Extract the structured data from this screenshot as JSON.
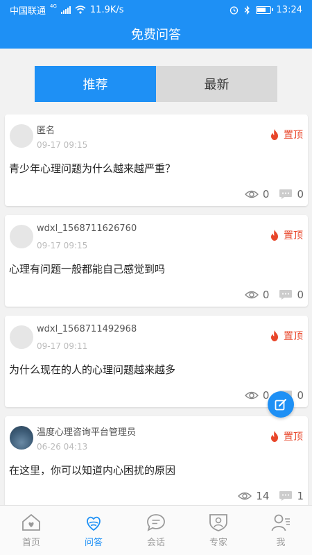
{
  "status": {
    "carrier": "中国联通",
    "network_badge": "4G",
    "speed": "11.9K/s",
    "time": "13:24"
  },
  "header": {
    "title": "免费问答"
  },
  "tabs": [
    {
      "label": "推荐",
      "active": true
    },
    {
      "label": "最新",
      "active": false
    }
  ],
  "posts": [
    {
      "user": "匿名",
      "time": "09-17 09:15",
      "pin_label": "置顶",
      "question": "青少年心理问题为什么越来越严重？",
      "views": "0",
      "comments": "0"
    },
    {
      "user": "wdxl_1568711626760",
      "time": "09-17 09:15",
      "pin_label": "置顶",
      "question": "心理有问题一般都能自己感觉到吗",
      "views": "0",
      "comments": "0"
    },
    {
      "user": "wdxl_1568711492968",
      "time": "09-17 09:11",
      "pin_label": "置顶",
      "question": "为什么现在的人的心理问题越来越多",
      "views": "0",
      "comments": "0"
    },
    {
      "user": "温度心理咨询平台管理员",
      "time": "06-26 04:13",
      "pin_label": "置顶",
      "question": "在这里，你可以知道内心困扰的原因",
      "views": "14",
      "comments": "1"
    }
  ],
  "nav": [
    {
      "label": "首页",
      "icon": "home-icon"
    },
    {
      "label": "问答",
      "icon": "qa-icon",
      "active": true
    },
    {
      "label": "会话",
      "icon": "chat-icon"
    },
    {
      "label": "专家",
      "icon": "expert-icon"
    },
    {
      "label": "我",
      "icon": "me-icon"
    }
  ],
  "colors": {
    "primary": "#1e90f5",
    "pin": "#e8462a",
    "tab_inactive": "#d9d9d9"
  }
}
